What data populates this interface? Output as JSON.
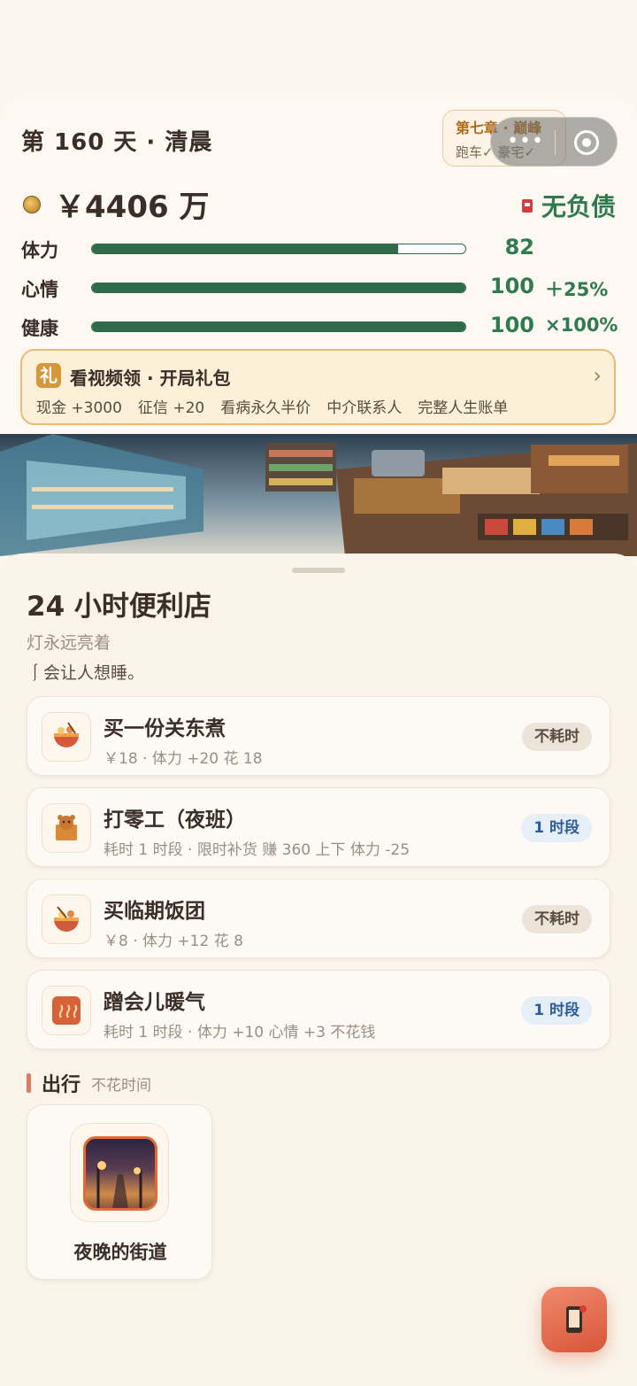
{
  "header": {
    "day_label": "第 160 天 · 清晨",
    "chapter_title": "第七章 · 巅峰",
    "chapter_sub": "跑车✓ 豪宅✓",
    "capsule_menu_icon": "more-dots-icon",
    "capsule_close_icon": "record-circle-icon",
    "money": "￥4406 万",
    "debt": "无负债",
    "stats": [
      {
        "label": "体力",
        "value": "82",
        "level": 0.82,
        "extra": ""
      },
      {
        "label": "心情",
        "value": "100",
        "level": 1.0,
        "extra": "＋25%"
      },
      {
        "label": "健康",
        "value": "100",
        "level": 1.0,
        "extra": "×100%"
      }
    ]
  },
  "gift": {
    "badge": "礼",
    "title": "看视频领 · 开局礼包",
    "chevron": "›",
    "items": [
      "现金 +3000",
      "征信 +20",
      "看病永久半价",
      "中介联系人",
      "完整人生账单"
    ]
  },
  "location": {
    "title": "24 小时便利店",
    "desc": "灯永远亮着",
    "desc2": "⎰会让人想睡。"
  },
  "actions": [
    {
      "icon": "oden-bowl-icon",
      "title": "买一份关东煮",
      "desc": "￥18 · 体力 +20 花 18",
      "tag": "不耗时",
      "tag_style": "gray"
    },
    {
      "icon": "bear-box-icon",
      "title": "打零工（夜班）",
      "desc": "耗时 1 时段 · 限时补货 赚 360 上下 体力 -25",
      "tag": "1 时段",
      "tag_style": "blue"
    },
    {
      "icon": "rice-ball-icon",
      "title": "买临期饭团",
      "desc": "￥8 · 体力 +12 花 8",
      "tag": "不耗时",
      "tag_style": "gray"
    },
    {
      "icon": "heater-icon",
      "title": "蹭会儿暖气",
      "desc": "耗时 1 时段 · 体力 +10 心情 +3 不花钱",
      "tag": "1 时段",
      "tag_style": "blue"
    }
  ],
  "travel": {
    "title": "出行",
    "subtitle": "不花时间",
    "destination": "夜晚的街道"
  },
  "fab_icon": "phone-icon"
}
